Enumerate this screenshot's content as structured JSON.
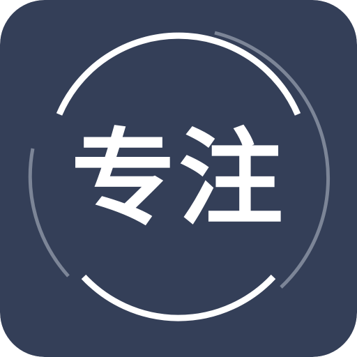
{
  "app_icon": {
    "label": "专注",
    "icon_name": "focus-ring-icon",
    "colors": {
      "background": "#343f58",
      "ring": "#ffffff",
      "accent_arc": "#7c8597"
    }
  }
}
